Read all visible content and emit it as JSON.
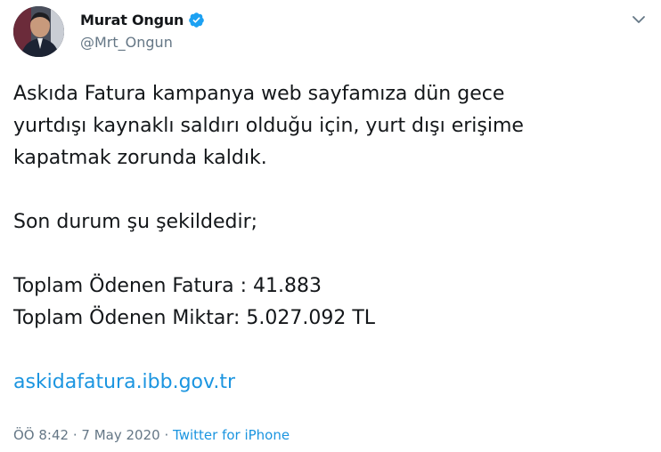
{
  "author": {
    "display_name": "Murat Ongun",
    "handle": "@Mrt_Ongun",
    "verified": true,
    "avatar_icon": "profile-photo"
  },
  "menu_icon": "chevron-down-icon",
  "tweet": {
    "line1": "Askıda Fatura kampanya web sayfamıza dün gece",
    "line2": "yurtdışı kaynaklı saldırı olduğu için, yurt dışı erişime",
    "line3": "kapatmak zorunda kaldık.",
    "line4": "Son durum şu şekildedir;",
    "line5": "Toplam Ödenen Fatura : 41.883",
    "line6": "Toplam Ödenen Miktar: 5.027.092 TL",
    "link": "askidafatura.ibb.gov.tr"
  },
  "meta": {
    "time": "ÖÖ 8:42",
    "sep1": "·",
    "date": "7 May 2020",
    "sep2": "·",
    "source": "Twitter for iPhone"
  },
  "colors": {
    "text": "#14171a",
    "secondary": "#657786",
    "link": "#1b95e0",
    "verified": "#1da1f2"
  }
}
